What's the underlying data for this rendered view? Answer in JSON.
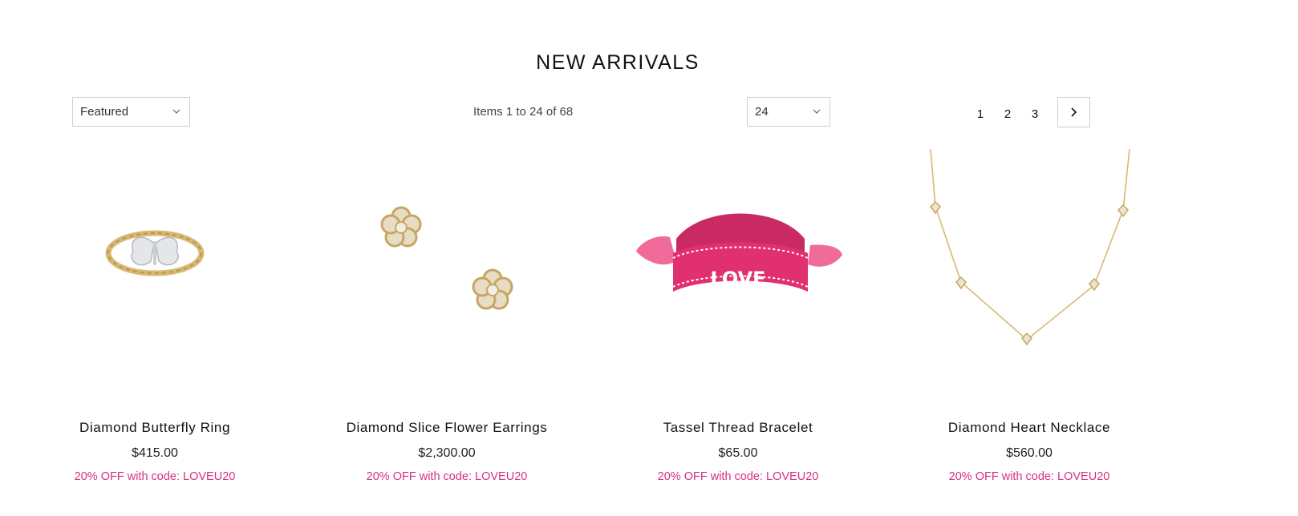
{
  "page": {
    "title": "NEW ARRIVALS"
  },
  "toolbar": {
    "sort_value": "Featured",
    "items_count": "Items 1 to 24 of 68",
    "limiter_value": "24",
    "pager": {
      "pages": [
        "1",
        "2",
        "3"
      ],
      "next_icon": "chevron-right-icon"
    }
  },
  "products": [
    {
      "name": "Diamond Butterfly Ring",
      "price": "$415.00",
      "promo": "20% OFF with code: LOVEU20",
      "image": "butterfly-ring-image"
    },
    {
      "name": "Diamond Slice Flower Earrings",
      "price": "$2,300.00",
      "promo": "20% OFF with code: LOVEU20",
      "image": "flower-earrings-image"
    },
    {
      "name": "Tassel Thread Bracelet",
      "price": "$65.00",
      "promo": "20% OFF with code: LOVEU20",
      "image": "tassel-bracelet-image",
      "image_text": "LOVE"
    },
    {
      "name": "Diamond Heart Necklace",
      "price": "$560.00",
      "promo": "20% OFF with code: LOVEU20",
      "image": "heart-necklace-image"
    }
  ],
  "colors": {
    "promo": "#d6307e",
    "border": "#cfcfcf",
    "bracelet_pink": "#e0306f",
    "gold": "#d9b873"
  }
}
